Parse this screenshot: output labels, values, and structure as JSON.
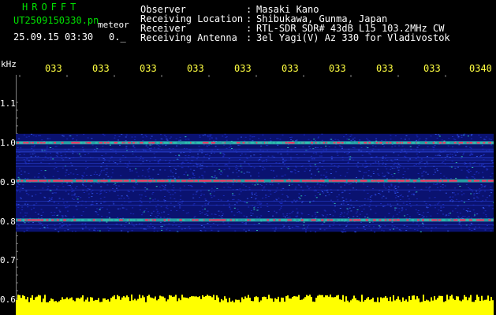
{
  "header": {
    "app_title": "HROFFT",
    "file_name": "UT2509150330.pn",
    "file_suffix": "meteor",
    "datetime": "25.09.15 03:30",
    "counter": "0._"
  },
  "meta": [
    {
      "label": "Observer",
      "sep": ":",
      "value": "Masaki Kano"
    },
    {
      "label": "Receiving Location",
      "sep": ":",
      "value": "Shibukawa, Gunma, Japan"
    },
    {
      "label": "Receiver",
      "sep": ":",
      "value": "RTL-SDR SDR# 43dB L15 103.2MHz CW"
    },
    {
      "label": "Receiving Antenna",
      "sep": ":",
      "value": "3el Yagi(V) Az 330 for Vladivostok"
    }
  ],
  "axis": {
    "unit": "kHz",
    "y_labels": [
      "1.1",
      "1.0",
      "0.9",
      "0.8",
      "0.7",
      "0.6"
    ],
    "x_ticks": [
      "033",
      "033",
      "033",
      "033",
      "033",
      "033",
      "033",
      "033",
      "033",
      "0340"
    ]
  },
  "spectrogram": {
    "freq_range_khz": [
      0.6,
      1.1
    ],
    "signal_lines_khz": [
      0.997,
      0.9,
      0.8
    ],
    "colors": {
      "background": "#000000",
      "noise": "#1a2ab8",
      "mid": "#30c0b0",
      "hot": "#ff3060",
      "amplitude": "#ffff00",
      "grid": "#ffffff"
    }
  }
}
